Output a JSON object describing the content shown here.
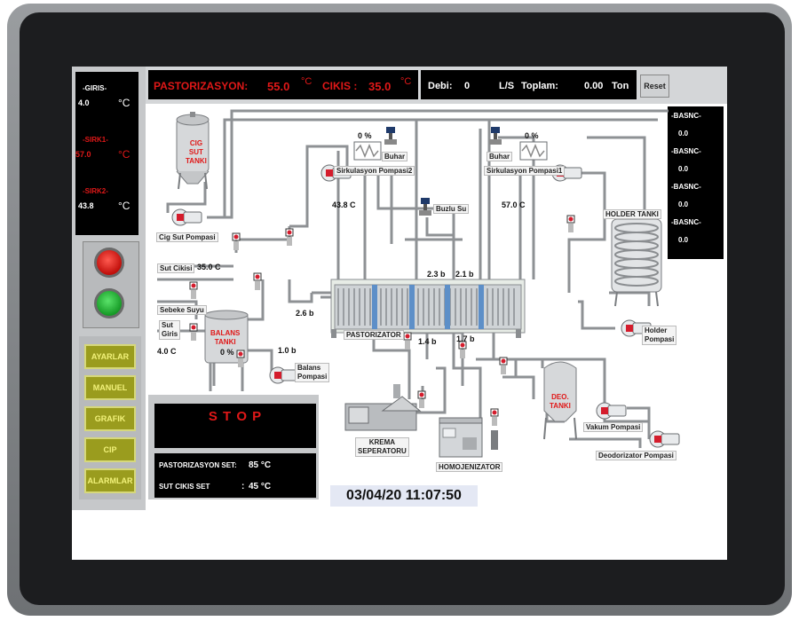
{
  "header": {
    "past_label": "PASTORIZASYON:",
    "past_value": "55.0",
    "past_unit": "°C",
    "cikis_label": "CIKIS :",
    "cikis_value": "35.0",
    "cikis_unit": "°C",
    "debi_label": "Debi:",
    "debi_value": "0",
    "ls_label": "L/S",
    "toplam_label": "Toplam:",
    "toplam_value": "0.00",
    "toplam_unit": "Ton",
    "reset_label": "Reset"
  },
  "left_temps": [
    {
      "label": "-GIRIS-",
      "value": "4.0",
      "unit": "°C"
    },
    {
      "label": "-SIRK1-",
      "value": "57.0",
      "unit": "°C"
    },
    {
      "label": "-SIRK2-",
      "value": "43.8",
      "unit": "°C"
    }
  ],
  "basinc": [
    {
      "label": "-BASNC-",
      "value": "0.0"
    },
    {
      "label": "-BASNC-",
      "value": "0.0"
    },
    {
      "label": "-BASNC-",
      "value": "0.0"
    },
    {
      "label": "-BASNC-",
      "value": "0.0"
    }
  ],
  "menu": [
    "AYARLAR",
    "MANUEL",
    "GRAFIK",
    "CIP",
    "ALARMLAR"
  ],
  "status": {
    "stop_label": "S T O P"
  },
  "setpoints": {
    "past_set_label": "PASTORIZASYON SET:",
    "past_set_value": "85 °C",
    "sut_set_label": "SUT CIKIS SET",
    "sut_set_colon": ":",
    "sut_set_value": "45 °C"
  },
  "datetime": "03/04/20 11:07:50",
  "diagram": {
    "cig_tank": [
      "CIG",
      "SUT",
      "TANKI"
    ],
    "cig_pump": "Cig Sut Pompasi",
    "sut_cikisi": "Sut Cikisi",
    "sut_cikisi_temp": "35.0 C",
    "sebeke": "Sebeke Suyu",
    "sut_giris": [
      "Sut",
      "Giris"
    ],
    "sut_giris_temp": "4.0 C",
    "balans_tank": [
      "BALANS",
      "TANKI"
    ],
    "balans_percent": "0 %",
    "balans_pump": [
      "Balans",
      "Pompasi"
    ],
    "p_1_0": "1.0 b",
    "p_2_6": "2.6 b",
    "valve2_percent": "0 %",
    "buhar2": "Buhar",
    "sirk2_pump": "Sirkulasyon Pompasi2",
    "temp_43_8": "43.8 C",
    "buzlu_su": "Buzlu Su",
    "valve1_percent": "0 %",
    "buhar1": "Buhar",
    "sirk1_pump": "Sirkulasyon Pompasi1",
    "temp_57": "57.0 C",
    "p_2_3": "2.3 b",
    "p_2_1": "2.1 b",
    "pastorizator": "PASTORIZATOR",
    "p_1_4": "1.4 b",
    "p_1_7": "1.7 b",
    "holder_tank": "HOLDER TANKI",
    "holder_pump": [
      "Holder",
      "Pompasi"
    ],
    "deo_tank": [
      "DEO.",
      "TANKI"
    ],
    "vakum_pump": "Vakum Pompasi",
    "deodorizator_pump": "Deodorizator Pompasi",
    "krema": [
      "KREMA",
      "SEPERATORU"
    ],
    "homojenizator": "HOMOJENIZATOR"
  },
  "colors": {
    "alarm_red": "#e01818",
    "button_olive": "#9a9c1e",
    "lamp_red": "#e0201c",
    "lamp_green": "#20b030"
  }
}
